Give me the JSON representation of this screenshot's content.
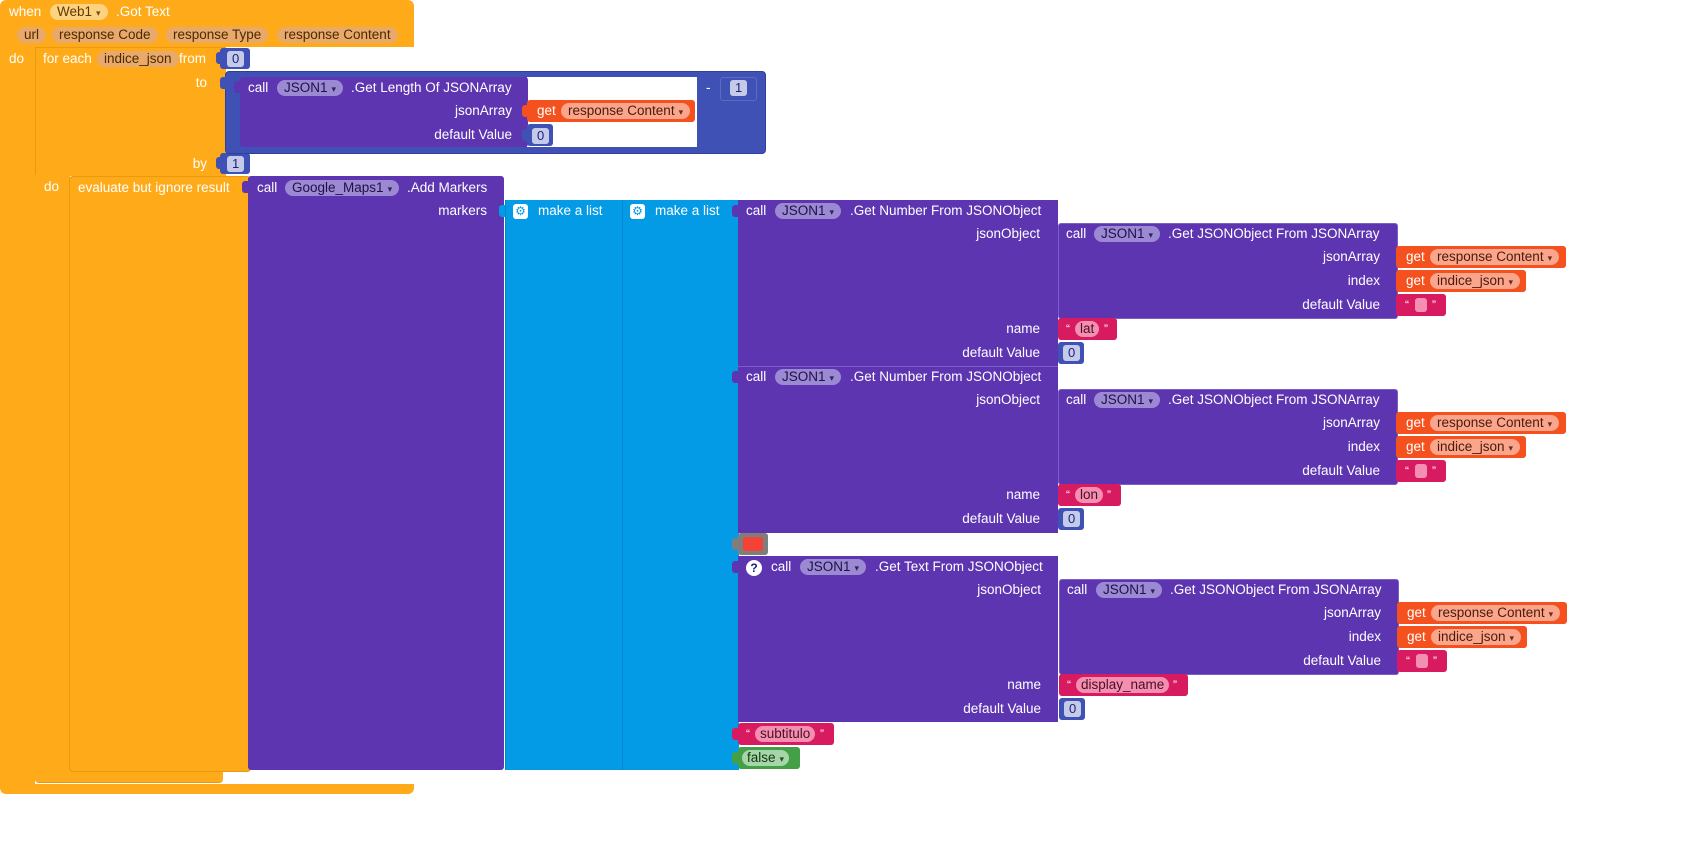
{
  "event": {
    "when_label": "when",
    "component": "Web1",
    "event_name": ".Got Text",
    "params": [
      "url",
      "response Code",
      "response Type",
      "response Content"
    ],
    "do_label": "do"
  },
  "loop": {
    "for_each_label": "for each",
    "var_name": "indice_json",
    "from_label": "from",
    "from_value": "0",
    "to_label": "to",
    "by_label": "by",
    "by_value": "1",
    "do_label": "do",
    "minus_op": "-",
    "minus_value": "1"
  },
  "length_call": {
    "call_label": "call",
    "component": "JSON1",
    "method": ".Get Length Of JSONArray",
    "json_array_label": "jsonArray",
    "default_value_label": "default Value",
    "default_value": "0"
  },
  "get_block": {
    "get_label": "get",
    "response_content": "response Content",
    "indice_json": "indice_json"
  },
  "evaluate": {
    "label": "evaluate but ignore result"
  },
  "maps_call": {
    "call_label": "call",
    "component": "Google_Maps1",
    "method": ".Add Markers",
    "markers_label": "markers"
  },
  "make_list_label": "make a list",
  "json_calls": {
    "call_label": "call",
    "component": "JSON1",
    "get_number": ".Get Number From JSONObject",
    "get_text": ".Get Text From JSONObject",
    "get_object": ".Get JSONObject From JSONArray",
    "json_object_label": "jsonObject",
    "json_array_label": "jsonArray",
    "index_label": "index",
    "default_value_label": "default Value",
    "name_label": "name",
    "zero": "0"
  },
  "strings": {
    "lat": "lat",
    "lon": "lon",
    "display_name": "display_name",
    "subtitulo": "subtitulo",
    "open_quote": "“",
    "close_quote": "”"
  },
  "bool_value": "false",
  "colors": {
    "control": "#FFAB19",
    "procedure": "#5E35B1",
    "math": "#3F51B5",
    "list": "#039BE5",
    "variable": "#F4511E",
    "text": "#D81B60",
    "logic": "#43A047",
    "color_swatch": "#F44336"
  },
  "icons": [
    "gear-icon",
    "help-icon",
    "dropdown-caret-icon"
  ]
}
